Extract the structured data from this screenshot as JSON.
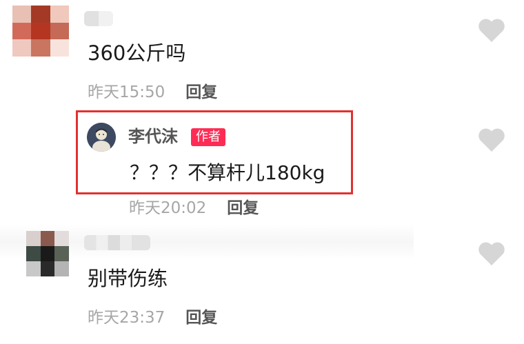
{
  "comments": [
    {
      "text": "360公斤吗",
      "time": "昨天15:50",
      "reply_label": "回复"
    },
    {
      "author": "李代沫",
      "badge": "作者",
      "text": "？？？不算杆儿180kg",
      "time": "昨天20:02",
      "reply_label": "回复"
    },
    {
      "text": "别带伤练",
      "time": "昨天23:37",
      "reply_label": "回复"
    }
  ],
  "colors": {
    "highlight": "#e23030",
    "badge": "#fe2c55",
    "heart": "#d6d6d6",
    "time": "#a6a6a6"
  },
  "icons": [
    "heart-icon",
    "avatar"
  ]
}
